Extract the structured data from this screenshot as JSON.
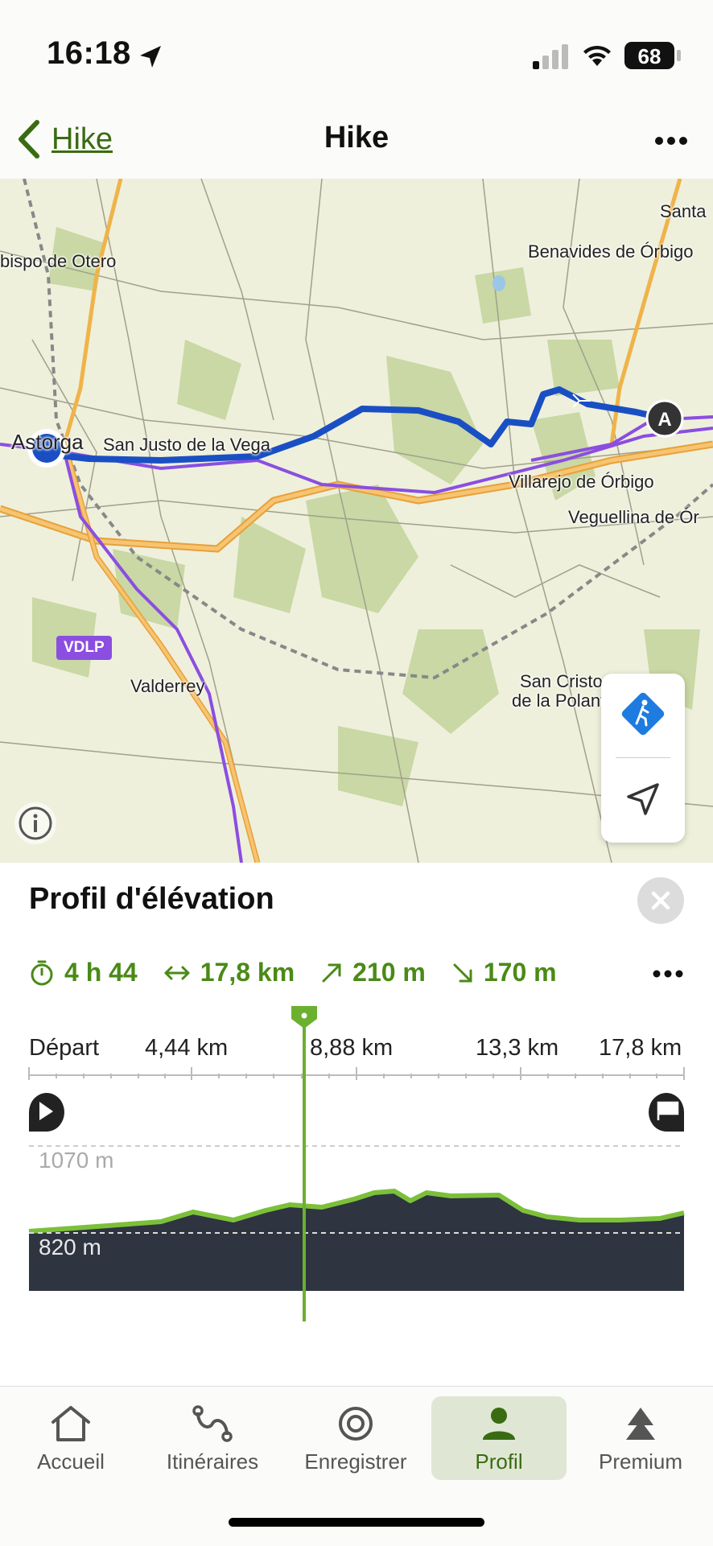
{
  "status": {
    "time": "16:18",
    "battery": "68"
  },
  "nav": {
    "back_label": "Hike",
    "title": "Hike"
  },
  "map": {
    "labels": {
      "obispo": "bispo de Otero",
      "benavides": "Benavides de Órbigo",
      "santa": "Santa",
      "astorga": "Astorga",
      "san_justo": "San Justo de la Vega",
      "villarejo": "Villarejo de Órbigo",
      "veguellina": "Veguellina de Ór",
      "valderrey": "Valderrey",
      "san_cristo": "San Cristo",
      "polantera": "de la Polantera"
    },
    "route_badge": "VDLP",
    "start_marker": "A"
  },
  "elevation": {
    "title": "Profil d'élévation",
    "stats": {
      "duration": "4 h 44",
      "distance": "17,8 km",
      "ascent": "210 m",
      "descent": "170 m"
    },
    "axis": [
      "Départ",
      "4,44 km",
      "8,88 km",
      "13,3 km",
      "17,8 km"
    ],
    "grid_labels": {
      "upper": "1070 m",
      "lower": "820 m"
    }
  },
  "tabs": [
    {
      "label": "Accueil",
      "icon": "home-icon"
    },
    {
      "label": "Itinéraires",
      "icon": "route-icon"
    },
    {
      "label": "Enregistrer",
      "icon": "record-icon"
    },
    {
      "label": "Profil",
      "icon": "profile-icon"
    },
    {
      "label": "Premium",
      "icon": "premium-icon"
    }
  ],
  "colors": {
    "accent": "#4a8a17",
    "route": "#1a4fc4",
    "alt_route": "#8b4ee0",
    "profile_fill": "#2e3440",
    "profile_line": "#7cc03a"
  }
}
